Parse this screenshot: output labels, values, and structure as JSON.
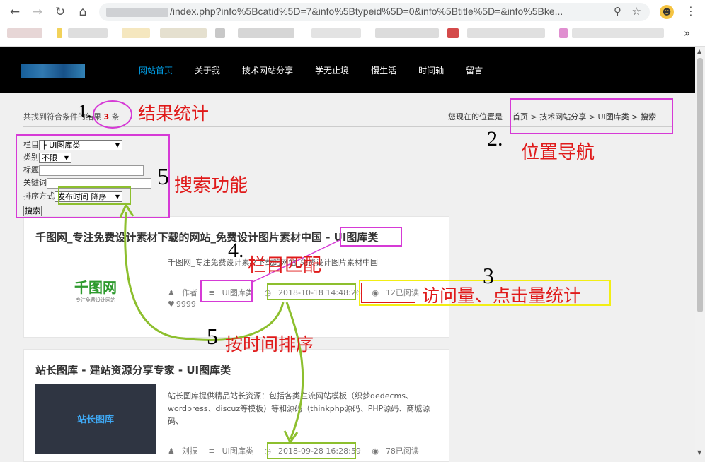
{
  "browser": {
    "url": "/index.php?info%5Bcatid%5D=7&info%5Btypeid%5D=0&info%5Btitle%5D=&info%5Bke..."
  },
  "site": {
    "nav": [
      "网站首页",
      "关于我",
      "技术网站分享",
      "学无止境",
      "慢生活",
      "时间轴",
      "留言"
    ]
  },
  "results": {
    "prefix": "共找到符合条件的结果",
    "count": "3",
    "suffix": "条"
  },
  "breadcrumb": {
    "label": "您现在的位置是",
    "items": [
      "首页",
      "技术网站分享",
      "UI图库类",
      "搜索"
    ]
  },
  "search": {
    "column_label": "栏目",
    "column_value": "├ UI图库类",
    "type_label": "类别",
    "type_value": "不限",
    "title_label": "标题",
    "keyword_label": "关键词",
    "sort_label": "排序方式",
    "sort_value": "发布时间 降序",
    "submit": "搜索"
  },
  "articles": [
    {
      "title": "千图网_专注免费设计素材下载的网站_免费设计图片素材中国 - UI图库类",
      "logo_main": "千图网",
      "logo_sub": "专注免费设计网站",
      "desc": "千图网_专注免费设计素材下载的网站_免费设计图片素材中国",
      "author": "作者",
      "category": "UI图库类",
      "date": "2018-10-18 14:48:26",
      "views": "12已阅读",
      "likes": "9999"
    },
    {
      "title": "站长图库 - 建站资源分享专家 - UI图库类",
      "logo_main": "站长图库",
      "desc": "站长图库提供精品站长资源：包括各类主流网站模板（织梦dedecms、wordpress、discuz等模板）等和源码（thinkphp源码、PHP源码、商城源码、",
      "author": "刘振",
      "category": "UI图库类",
      "date": "2018-09-28 16:28:59",
      "views": "78已阅读"
    }
  ],
  "annotations": {
    "a1": "1.",
    "a1_text": "结果统计",
    "a2": "2.",
    "a2_text": "位置导航",
    "a3": "3",
    "a3_text": "访问量、点击量统计",
    "a4": "4.",
    "a4_text": "栏目匹配",
    "a5a": "5",
    "a5a_text": "搜索功能",
    "a5b": "5",
    "a5b_text": "按时间排序"
  },
  "colors": {
    "magenta": "#d63ad6",
    "green": "#8dbf2e",
    "yellow": "#f2ee14",
    "red": "#e01a1a",
    "nav_active": "#00a0e9"
  }
}
